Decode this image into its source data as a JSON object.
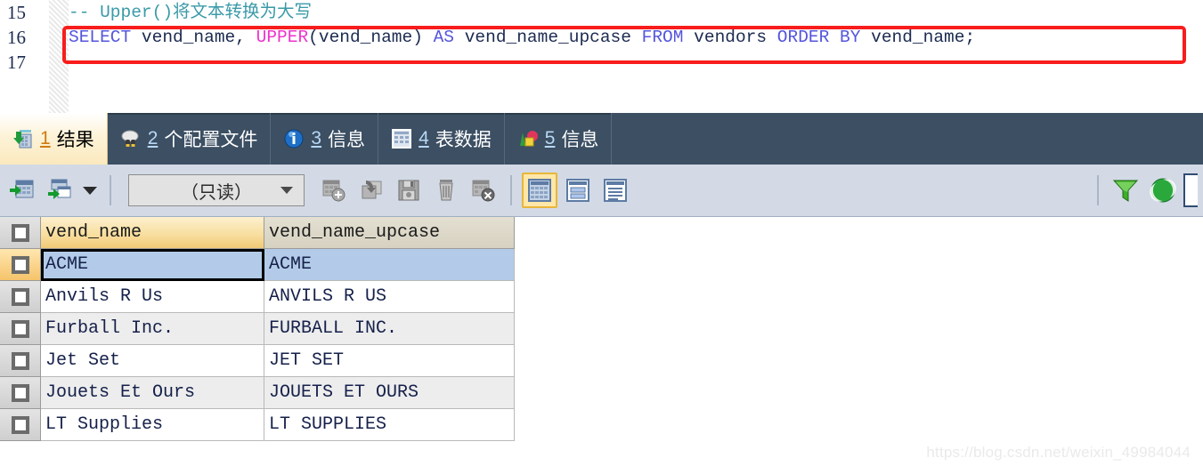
{
  "editor": {
    "line_numbers": [
      "15",
      "16",
      "17"
    ],
    "comment_line": "-- Upper()将文本转换为大写",
    "sql": {
      "select_kw": "SELECT",
      "col1": " vend_name, ",
      "upper_fn": "UPPER",
      "upper_args": "(vend_name) ",
      "as_kw": "AS",
      "alias": " vend_name_upcase ",
      "from_kw": "FROM",
      "table": " vendors ",
      "order_kw": "ORDER",
      "by_kw": " BY",
      "order_col": " vend_name;"
    },
    "full_statement": "SELECT vend_name, UPPER(vend_name) AS vend_name_upcase FROM vendors ORDER BY vend_name;",
    "highlight_color": "#f81d1d"
  },
  "tabs": [
    {
      "num": "1",
      "label": "结果",
      "icon": "result-grid-icon",
      "active": true
    },
    {
      "num": "2",
      "label": "个配置文件",
      "icon": "profile-icon",
      "active": false
    },
    {
      "num": "3",
      "label": "信息",
      "icon": "info-icon",
      "active": false
    },
    {
      "num": "4",
      "label": "表数据",
      "icon": "table-data-icon",
      "active": false
    },
    {
      "num": "5",
      "label": "信息",
      "icon": "chart-info-icon",
      "active": false
    }
  ],
  "toolbar": {
    "export_grid": "export-grid-icon",
    "export_grid_menu": "export-grid-menu-icon",
    "mode_select": {
      "value": "（只读）",
      "options": [
        "（只读）"
      ]
    },
    "add_row": "add-row-icon",
    "revert": "revert-icon",
    "save": "save-icon",
    "delete": "delete-row-icon",
    "cancel": "cancel-edit-icon",
    "view_grid": "grid-view-icon",
    "view_form": "form-view-icon",
    "view_text": "text-view-icon",
    "filter": "filter-icon",
    "refresh": "refresh-icon"
  },
  "result_grid": {
    "columns": [
      "vend_name",
      "vend_name_upcase"
    ],
    "rows": [
      {
        "vend_name": "ACME",
        "vend_name_upcase": "ACME",
        "selected": true
      },
      {
        "vend_name": "Anvils R Us",
        "vend_name_upcase": "ANVILS R US",
        "selected": false
      },
      {
        "vend_name": "Furball Inc.",
        "vend_name_upcase": "FURBALL INC.",
        "selected": false
      },
      {
        "vend_name": "Jet Set",
        "vend_name_upcase": "JET SET",
        "selected": false
      },
      {
        "vend_name": "Jouets Et Ours",
        "vend_name_upcase": "JOUETS ET OURS",
        "selected": false
      },
      {
        "vend_name": "LT Supplies",
        "vend_name_upcase": "LT SUPPLIES",
        "selected": false
      }
    ],
    "selection_color": "#b3cbe8",
    "active_header_color": "#f2c977"
  },
  "watermark": "https://blog.csdn.net/weixin_49984044"
}
